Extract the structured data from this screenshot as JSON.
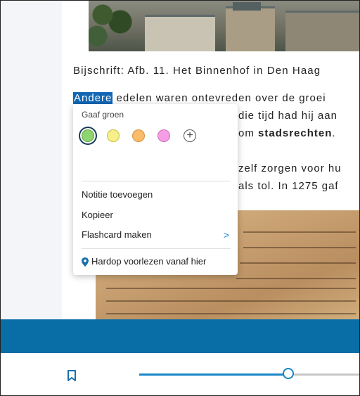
{
  "content": {
    "caption": "Bijschrift: Afb. 11. Het Binnenhof in Den Haag",
    "paragraph_lines": [
      {
        "highlight": "Andere",
        "text": " edelen waren ontevreden over de groei"
      },
      {
        "text": "die tijd had hij aan"
      },
      {
        "text": "om ",
        "bold": "stadsrechten",
        "tail": "."
      },
      {
        "text": "zelf zorgen voor hu"
      },
      {
        "text": "als tol. In 1275 gaf"
      }
    ]
  },
  "popup": {
    "title": "Gaaf groen",
    "swatches": [
      {
        "name": "green",
        "color": "#8ed46f",
        "border": "#5aa63d",
        "selected": true
      },
      {
        "name": "yellow",
        "color": "#f6ef8a",
        "border": "#c9bf3a"
      },
      {
        "name": "orange",
        "color": "#f8bc6a",
        "border": "#d4923a"
      },
      {
        "name": "pink",
        "color": "#f59ee6",
        "border": "#cc6cbd"
      }
    ],
    "add_symbol": "+",
    "menu": {
      "add_note": "Notitie toevoegen",
      "copy": "Kopieer",
      "flashcard": "Flashcard maken",
      "flashcard_chevron": ">",
      "read_aloud": "Hardop voorlezen vanaf hier"
    }
  },
  "toolbar": {
    "progress": 0.8,
    "accent_color": "#1a86c6",
    "icon": "bookmark-icon"
  },
  "colors": {
    "banner": "#0a6ea6",
    "highlight": "#1267b5"
  }
}
